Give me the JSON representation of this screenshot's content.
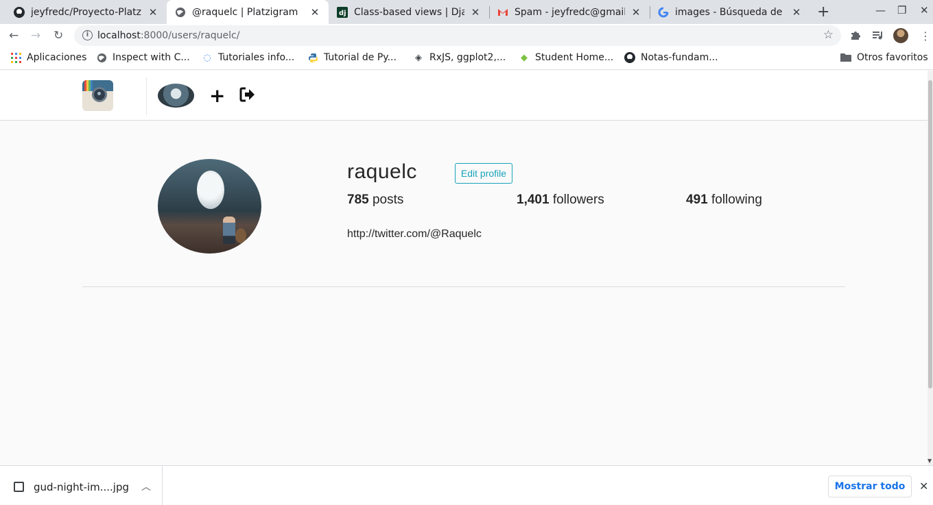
{
  "browser": {
    "tabs": [
      {
        "title": "jeyfredc/Proyecto-Platzigram",
        "favicon": "github-icon",
        "active": false
      },
      {
        "title": "@raquelc | Platzigram",
        "favicon": "globe-icon",
        "active": true
      },
      {
        "title": "Class-based views | Django",
        "favicon": "django-icon",
        "active": false
      },
      {
        "title": "Spam - jeyfredc@gmail.com",
        "favicon": "gmail-icon",
        "active": false
      },
      {
        "title": "images - Búsqueda de Google",
        "favicon": "google-icon",
        "active": false
      }
    ],
    "address": {
      "host": "localhost",
      "path": ":8000/users/raquelc/"
    },
    "bookmarks": [
      {
        "label": "Aplicaciones",
        "icon": "apps-grid-icon"
      },
      {
        "label": "Inspect with C...",
        "icon": "globe-icon"
      },
      {
        "label": "Tutoriales info...",
        "icon": "bulb-icon"
      },
      {
        "label": "Tutorial de Py...",
        "icon": "python-icon"
      },
      {
        "label": "RxJS, ggplot2,...",
        "icon": "diamond-icon"
      },
      {
        "label": "Student Home...",
        "icon": "student-icon"
      },
      {
        "label": "Notas-fundam...",
        "icon": "github-icon"
      }
    ],
    "other_bookmarks": "Otros favoritos"
  },
  "profile": {
    "username": "raquelc",
    "edit_label": "Edit profile",
    "posts_count": "785",
    "posts_label": "posts",
    "followers_count": "1,401",
    "followers_label": "followers",
    "following_count": "491",
    "following_label": "following",
    "website": "http://twitter.com/@Raquelc"
  },
  "downloads": {
    "file": "gud-night-im....jpg",
    "show_all": "Mostrar todo"
  },
  "colors": {
    "accent": "#17a2b8",
    "link_blue": "#1a73e8"
  }
}
